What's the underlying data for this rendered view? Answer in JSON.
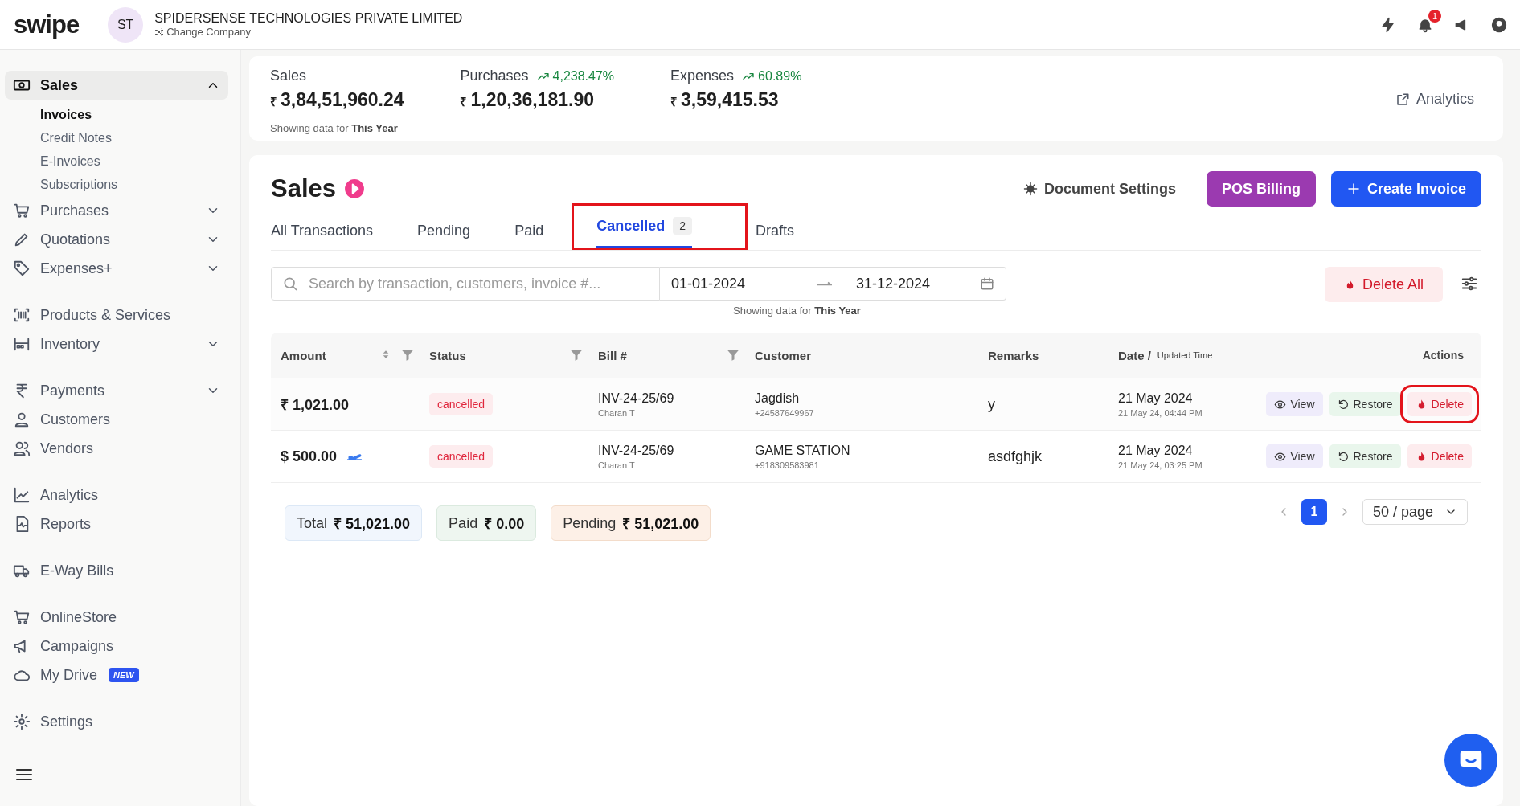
{
  "header": {
    "logo": "swipe",
    "avatar": "ST",
    "company": "SPIDERSENSE TECHNOLOGIES PRIVATE LIMITED",
    "change_company": "Change Company",
    "notification_count": "1"
  },
  "sidebar": {
    "groups": [
      [
        {
          "label": "Sales",
          "kind": "menu",
          "expanded": true,
          "selected": true,
          "children": [
            {
              "label": "Invoices",
              "selected": true
            },
            {
              "label": "Credit Notes",
              "selected": false
            },
            {
              "label": "E-Invoices",
              "selected": false
            },
            {
              "label": "Subscriptions",
              "selected": false
            }
          ]
        },
        {
          "label": "Purchases",
          "kind": "menu",
          "expanded": false,
          "selected": false
        },
        {
          "label": "Quotations",
          "kind": "menu",
          "expanded": false,
          "selected": false
        },
        {
          "label": "Expenses+",
          "kind": "menu",
          "expanded": false,
          "selected": false
        }
      ],
      [
        {
          "label": "Products & Services",
          "kind": "link",
          "selected": false
        },
        {
          "label": "Inventory",
          "kind": "menu",
          "expanded": false,
          "selected": false
        }
      ],
      [
        {
          "label": "Payments",
          "kind": "menu",
          "expanded": false,
          "selected": false
        },
        {
          "label": "Customers",
          "kind": "link",
          "selected": false
        },
        {
          "label": "Vendors",
          "kind": "link",
          "selected": false
        }
      ],
      [
        {
          "label": "Analytics",
          "kind": "link",
          "selected": false
        },
        {
          "label": "Reports",
          "kind": "link",
          "selected": false
        }
      ],
      [
        {
          "label": "E-Way Bills",
          "kind": "link",
          "selected": false
        }
      ],
      [
        {
          "label": "OnlineStore",
          "kind": "link",
          "selected": false
        },
        {
          "label": "Campaigns",
          "kind": "link",
          "selected": false
        },
        {
          "label": "My Drive",
          "kind": "link",
          "selected": false,
          "badge": "NEW"
        }
      ],
      [
        {
          "label": "Settings",
          "kind": "link",
          "selected": false
        }
      ]
    ]
  },
  "stats": {
    "items": [
      {
        "label": "Sales",
        "currency": "₹",
        "value": "3,84,51,960.24"
      },
      {
        "label": "Purchases",
        "change": "4,238.47%",
        "currency": "₹",
        "value": "1,20,36,181.90"
      },
      {
        "label": "Expenses",
        "change": "60.89%",
        "currency": "₹",
        "value": "3,59,415.53"
      }
    ],
    "note": "Showing data for **This Year**",
    "analytics_link": "Analytics"
  },
  "main": {
    "title": "Sales",
    "buttons": [
      {
        "label": "Document Settings",
        "kind": "settings"
      },
      {
        "label": "POS Billing",
        "kind": "pos"
      },
      {
        "label": "Create Invoice",
        "kind": "create"
      }
    ],
    "tabs": [
      {
        "label": "All Transactions",
        "selected": false,
        "highlighted": false
      },
      {
        "label": "Pending",
        "selected": false,
        "highlighted": false
      },
      {
        "label": "Paid",
        "selected": false,
        "highlighted": false
      },
      {
        "label": "Cancelled",
        "count": "2",
        "selected": true,
        "highlighted": true
      },
      {
        "label": "Drafts",
        "selected": false,
        "highlighted": false
      }
    ],
    "search": {
      "placeholder": "Search by transaction, customers, invoice #..."
    },
    "date_range": {
      "start": "01-01-2024",
      "end": "31-12-2024",
      "note": "Showing data for **This Year**"
    },
    "delete_all": "Delete All",
    "table": {
      "columns": [
        {
          "label": "Amount",
          "sortable": true,
          "filterable": true
        },
        {
          "label": "Status",
          "sortable": false,
          "filterable": true
        },
        {
          "label": "Bill #",
          "sortable": false,
          "filterable": true
        },
        {
          "label": "Customer",
          "sortable": false,
          "filterable": false
        },
        {
          "label": "Remarks",
          "sortable": false,
          "filterable": false
        },
        {
          "label": "Date /",
          "sub": "Updated Time",
          "sortable": false,
          "filterable": false
        },
        {
          "label": "Actions",
          "sortable": false,
          "filterable": false
        }
      ],
      "rows": [
        {
          "amount": "₹ 1,021.00",
          "international": false,
          "status": "cancelled",
          "bill": "INV-24-25/69",
          "created_by": "Charan T",
          "customer": "Jagdish",
          "phone": "+24587649967",
          "remarks": "y",
          "date": "21 May 2024",
          "updated": "21 May 24, 04:44 PM",
          "actions": [
            {
              "label": "View",
              "kind": "view",
              "highlighted": false
            },
            {
              "label": "Restore",
              "kind": "restore",
              "highlighted": false
            },
            {
              "label": "Delete",
              "kind": "delete",
              "highlighted": true
            }
          ]
        },
        {
          "amount": "$ 500.00",
          "international": true,
          "status": "cancelled",
          "bill": "INV-24-25/69",
          "created_by": "Charan T",
          "customer": "GAME STATION",
          "phone": "+918309583981",
          "remarks": "asdfghjk",
          "date": "21 May 2024",
          "updated": "21 May 24, 03:25 PM",
          "actions": [
            {
              "label": "View",
              "kind": "view",
              "highlighted": false
            },
            {
              "label": "Restore",
              "kind": "restore",
              "highlighted": false
            },
            {
              "label": "Delete",
              "kind": "delete",
              "highlighted": false
            }
          ]
        }
      ]
    },
    "totals": [
      {
        "label": "Total",
        "value": "₹ 51,021.00",
        "kind": "total"
      },
      {
        "label": "Paid",
        "value": "₹ 0.00",
        "kind": "paid"
      },
      {
        "label": "Pending",
        "value": "₹ 51,021.00",
        "kind": "pending"
      }
    ],
    "pagination": {
      "pages": [
        {
          "label": "1",
          "selected": true
        }
      ],
      "page_size": "50 / page"
    }
  }
}
